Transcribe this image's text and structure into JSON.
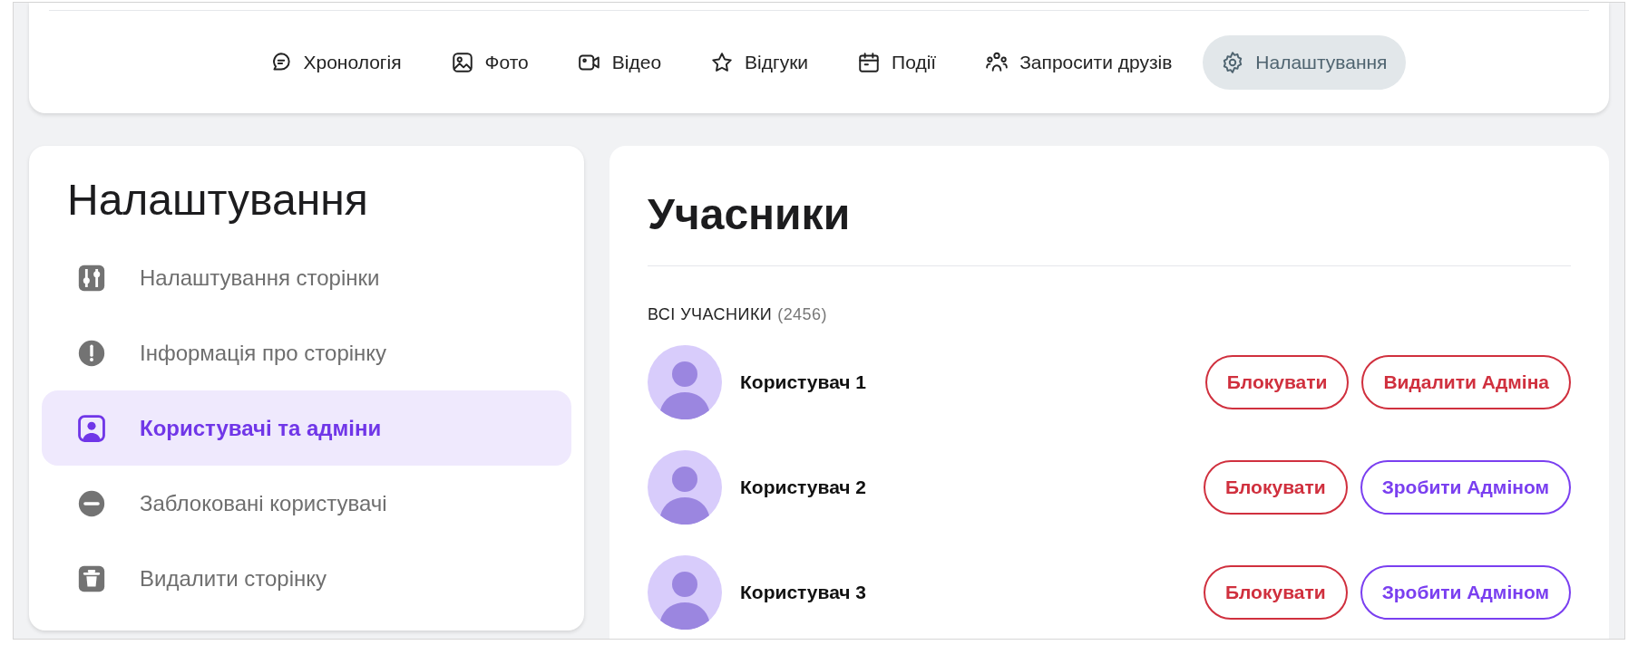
{
  "nav_tabs": [
    {
      "label": "Хронологія",
      "kind": "timeline",
      "selected": false
    },
    {
      "label": "Фото",
      "kind": "photo",
      "selected": false
    },
    {
      "label": "Відео",
      "kind": "video",
      "selected": false
    },
    {
      "label": "Відгуки",
      "kind": "star",
      "selected": false
    },
    {
      "label": "Події",
      "kind": "calendar",
      "selected": false
    },
    {
      "label": "Запросити друзів",
      "kind": "people",
      "selected": false
    },
    {
      "label": "Налаштування",
      "kind": "gear",
      "selected": true
    }
  ],
  "sidebar": {
    "title": "Налаштування",
    "items": [
      {
        "label": "Налаштування сторінки",
        "kind": "sliders",
        "selected": false
      },
      {
        "label": "Інформація про сторінку",
        "kind": "info",
        "selected": false
      },
      {
        "label": "Користувачі та адміни",
        "kind": "user",
        "selected": true
      },
      {
        "label": "Заблоковані користувачі",
        "kind": "minus",
        "selected": false
      },
      {
        "label": "Видалити сторінку",
        "kind": "trash",
        "selected": false
      }
    ]
  },
  "members": {
    "title": "Учасники",
    "section_label": "ВСІ УЧАСНИКИ",
    "count": "(2456)",
    "rows": [
      {
        "name": "Користувач 1",
        "actions": [
          {
            "label": "Блокувати",
            "kind": "danger"
          },
          {
            "label": "Видалити Адміна",
            "kind": "danger"
          }
        ]
      },
      {
        "name": "Користувач 2",
        "actions": [
          {
            "label": "Блокувати",
            "kind": "danger"
          },
          {
            "label": "Зробити Адміном",
            "kind": "primary"
          }
        ]
      },
      {
        "name": "Користувач 3",
        "actions": [
          {
            "label": "Блокувати",
            "kind": "danger"
          },
          {
            "label": "Зробити Адміном",
            "kind": "primary"
          }
        ]
      }
    ]
  }
}
